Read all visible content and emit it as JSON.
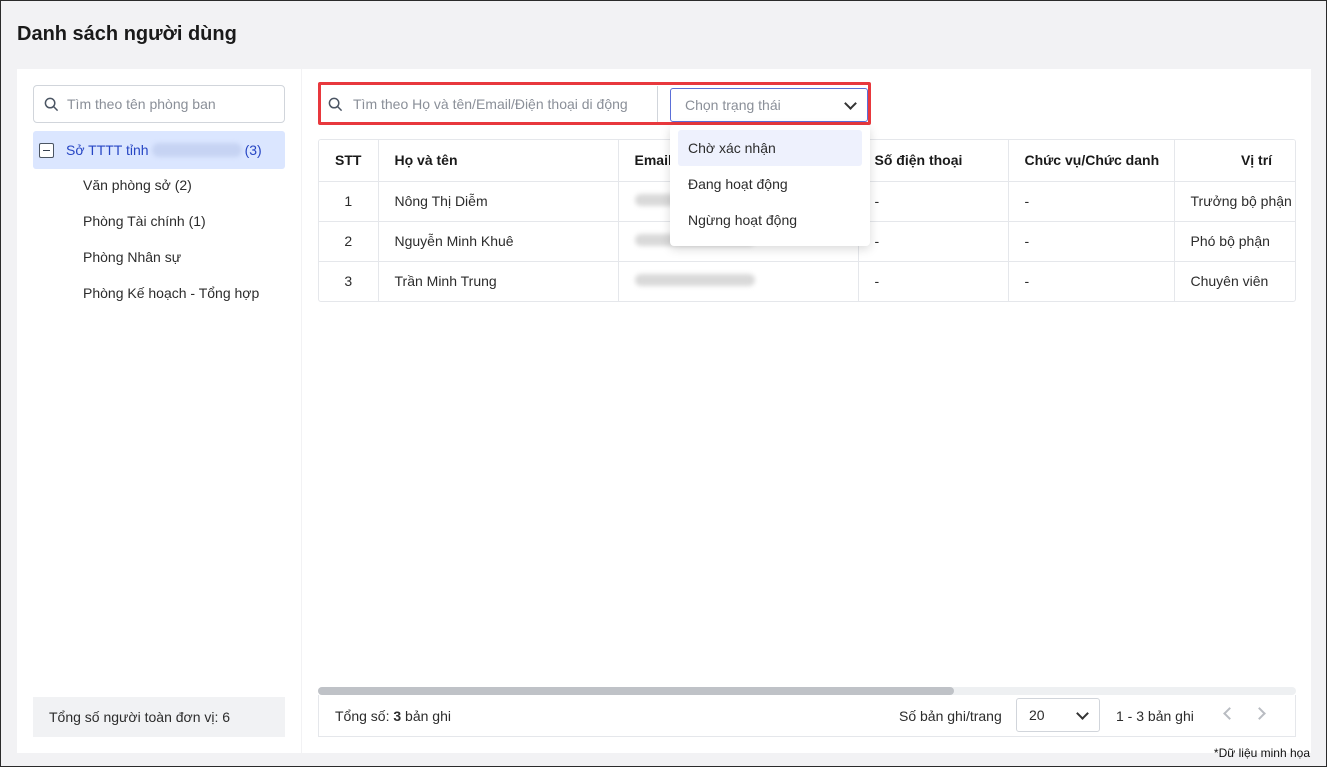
{
  "page": {
    "title": "Danh sách người dùng",
    "footnote": "*Dữ liệu minh họa"
  },
  "sidebar": {
    "search_placeholder": "Tìm theo tên phòng ban",
    "root": {
      "label": "Sở TTTT tỉnh",
      "count": "(3)"
    },
    "children": [
      {
        "label": "Văn phòng sở  (2)"
      },
      {
        "label": "Phòng Tài chính  (1)"
      },
      {
        "label": "Phòng Nhân sự"
      },
      {
        "label": "Phòng Kế hoạch - Tổng hợp"
      }
    ],
    "footer": "Tổng số người toàn đơn vị: 6"
  },
  "filters": {
    "search_placeholder": "Tìm theo Họ và tên/Email/Điện thoại di động",
    "status_placeholder": "Chọn trạng thái",
    "status_options": [
      "Chờ xác nhận",
      "Đang hoạt động",
      "Ngừng hoạt động"
    ]
  },
  "table": {
    "columns": [
      "STT",
      "Họ và tên",
      "Email",
      "Số điện thoại",
      "Chức vụ/Chức danh",
      "Vị trí"
    ],
    "rows": [
      {
        "stt": "1",
        "name": "Nông Thị Diễm",
        "phone": "-",
        "title": "-",
        "position": "Trưởng bộ phận"
      },
      {
        "stt": "2",
        "name": "Nguyễn Minh Khuê",
        "phone": "-",
        "title": "-",
        "position": "Phó bộ phận"
      },
      {
        "stt": "3",
        "name": "Trần Minh Trung",
        "phone": "-",
        "title": "-",
        "position": "Chuyên viên"
      }
    ]
  },
  "footer": {
    "total_prefix": "Tổng số: ",
    "total_count": "3",
    "total_suffix": " bản ghi",
    "per_page_label": "Số bản ghi/trang",
    "per_page_value": "20",
    "range": "1 - 3 bản ghi"
  },
  "colors": {
    "accent": "#2746c4",
    "highlight_border": "#e8383d",
    "selected_row": "#dbe6ff"
  },
  "scroll": {
    "horizontal_visible_fraction": 0.65
  }
}
